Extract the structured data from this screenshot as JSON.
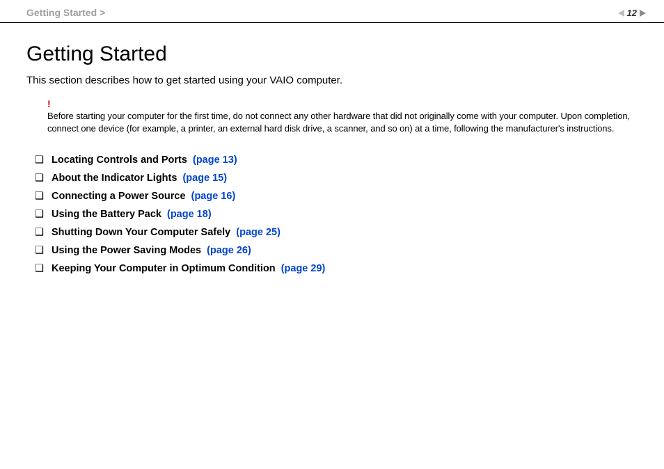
{
  "header": {
    "breadcrumb": "Getting Started >",
    "page_number": "12"
  },
  "page": {
    "title": "Getting Started",
    "intro": "This section describes how to get started using your VAIO computer.",
    "alert_mark": "!",
    "alert_text": "Before starting your computer for the first time, do not connect any other hardware that did not originally come with your computer. Upon completion, connect one device (for example, a printer, an external hard disk drive, a scanner, and so on) at a time, following the manufacturer's instructions."
  },
  "links": [
    {
      "label": "Locating Controls and Ports",
      "page": "(page 13)"
    },
    {
      "label": "About the Indicator Lights",
      "page": "(page 15)"
    },
    {
      "label": "Connecting a Power Source",
      "page": "(page 16)"
    },
    {
      "label": "Using the Battery Pack",
      "page": "(page 18)"
    },
    {
      "label": "Shutting Down Your Computer Safely",
      "page": "(page 25)"
    },
    {
      "label": "Using the Power Saving Modes",
      "page": "(page 26)"
    },
    {
      "label": "Keeping Your Computer in Optimum Condition",
      "page": "(page 29)"
    }
  ],
  "bullet": "❑"
}
